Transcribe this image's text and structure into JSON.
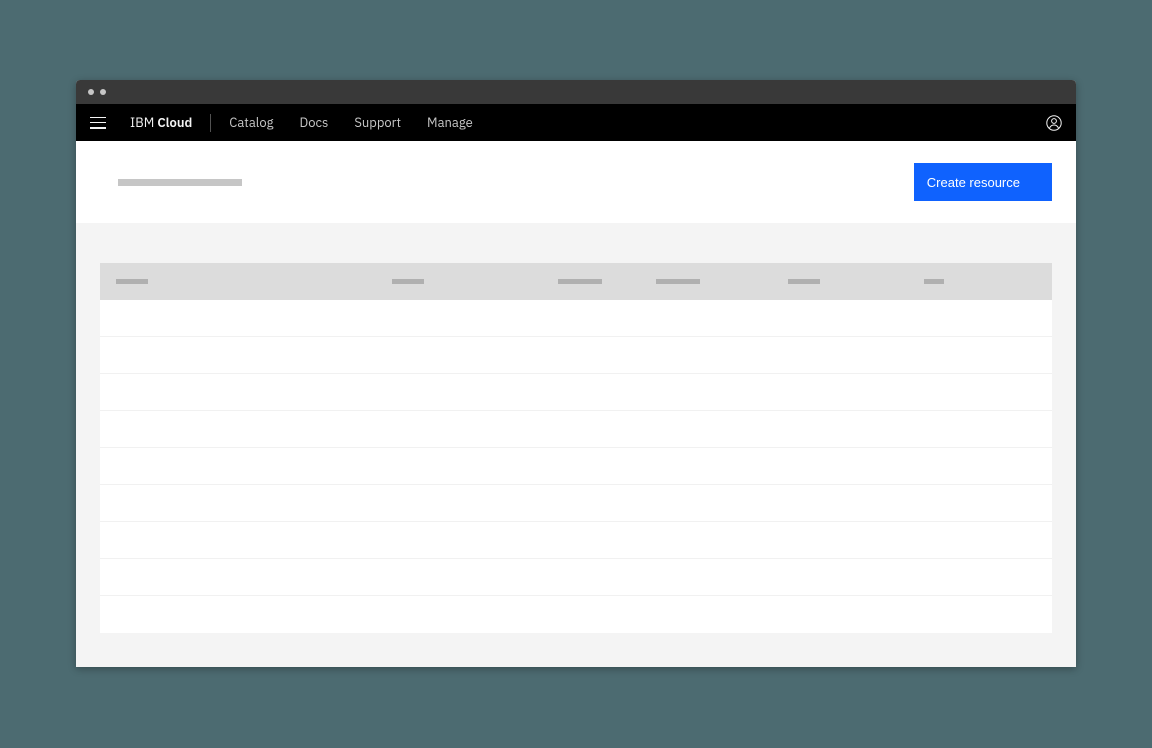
{
  "brand": {
    "prefix": "IBM",
    "suffix": "Cloud"
  },
  "nav": {
    "catalog": "Catalog",
    "docs": "Docs",
    "support": "Support",
    "manage": "Manage"
  },
  "header": {
    "create_button": "Create resource"
  },
  "table": {
    "columns": [
      "",
      "",
      "",
      "",
      "",
      ""
    ],
    "row_count": 9
  }
}
